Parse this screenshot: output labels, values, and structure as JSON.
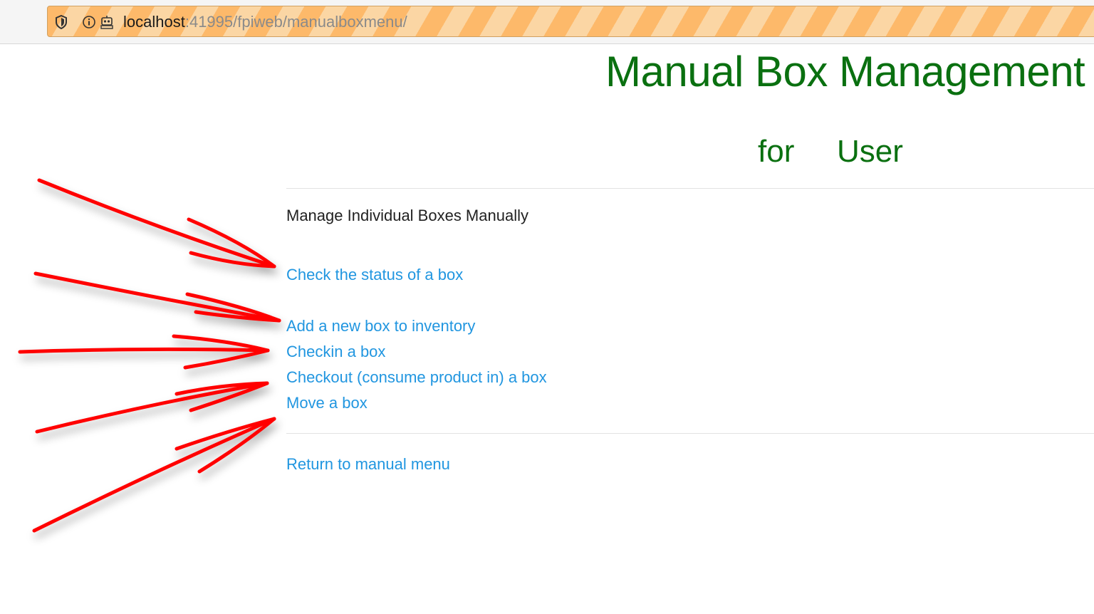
{
  "browser": {
    "url_host": "localhost",
    "url_rest": ":41995/fpiweb/manualboxmenu/",
    "icons": [
      "shield-icon",
      "info-icon",
      "robot-icon"
    ]
  },
  "header": {
    "title": "Manual Box Management",
    "subtitle_for": "for",
    "subtitle_user": "User"
  },
  "section": {
    "heading": "Manage Individual Boxes Manually"
  },
  "links": {
    "check_status": "Check the status of a box",
    "add_box": "Add a new box to inventory",
    "checkin": "Checkin a box",
    "checkout": "Checkout (consume product in) a box",
    "move": "Move a box",
    "return": "Return to manual menu"
  },
  "colors": {
    "title_green": "#0a7010",
    "link_blue": "#2196e0",
    "annotation_red": "#ff0000",
    "urlbar_stripe_a": "#fdb96a",
    "urlbar_stripe_b": "#fbd6a4"
  }
}
